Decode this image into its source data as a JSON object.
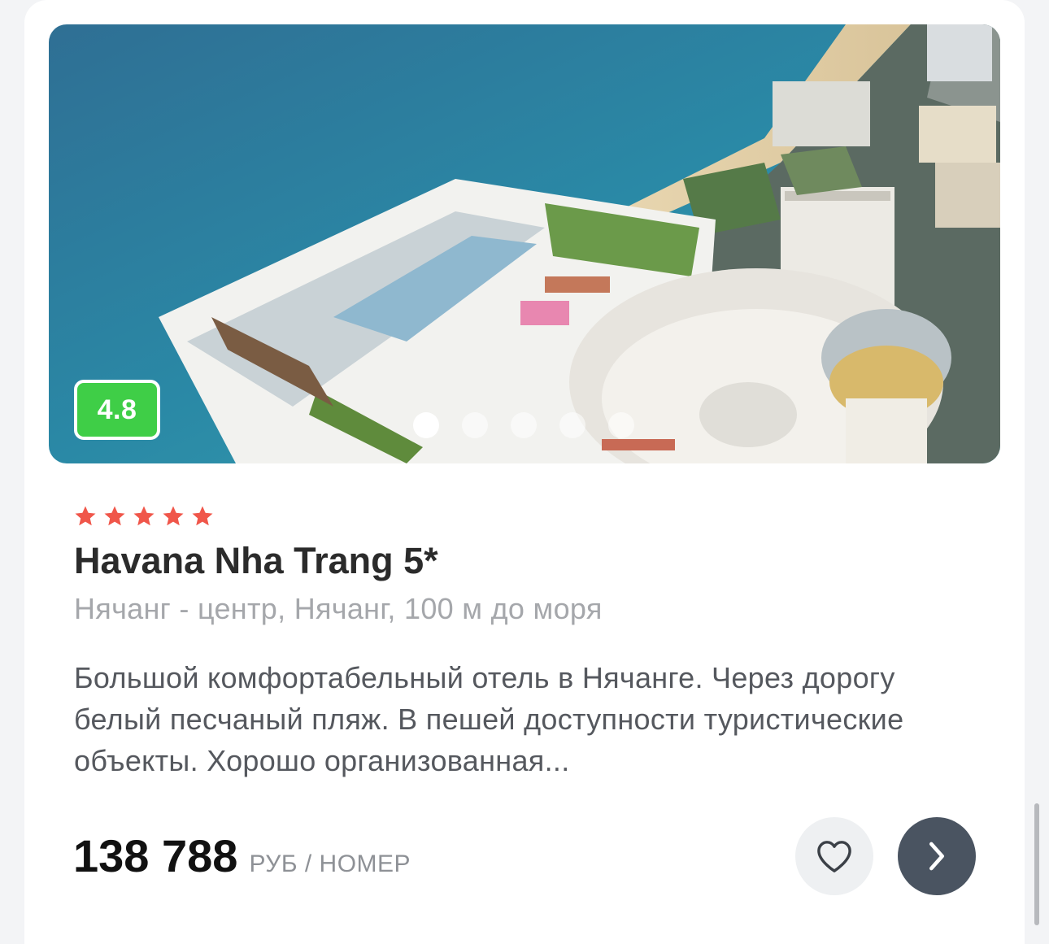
{
  "hotel": {
    "rating": "4.8",
    "stars_count": 5,
    "name": "Havana Nha Trang 5*",
    "location": "Нячанг - центр, Нячанг, 100 м до моря",
    "description": "Большой комфортабельный отель в Нячанге. Через дорогу белый песчаный пляж. В пешей доступности туристические объекты. Хорошо организованная...",
    "price": "138 788",
    "price_unit": "РУБ / НОМЕР"
  },
  "gallery": {
    "total_photos": 5,
    "active_index": 0
  },
  "icons": {
    "favorite": "heart-outline-icon",
    "details": "chevron-right-icon",
    "star": "star-icon"
  },
  "colors": {
    "rating_badge": "#3fce47",
    "star": "#f0564a",
    "details_button": "#4a5461",
    "favorite_button": "#eef0f2"
  }
}
